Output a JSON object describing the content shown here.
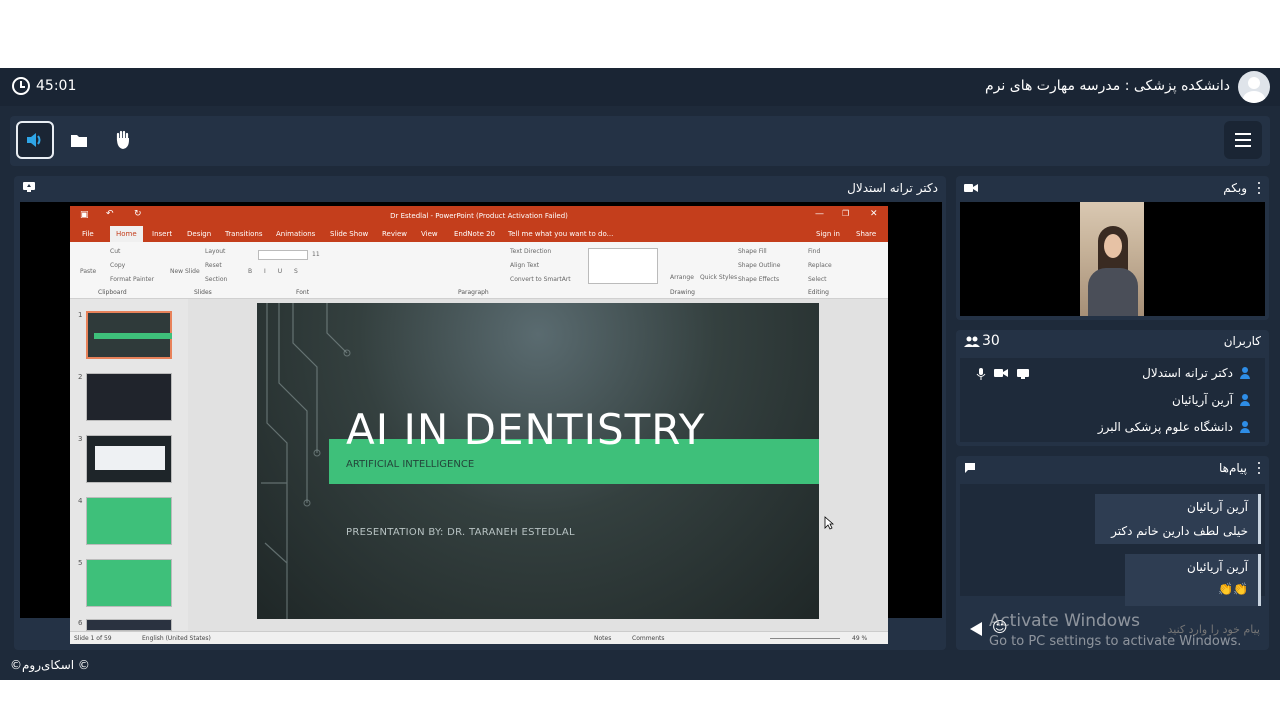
{
  "top_bar": {
    "timer": "45:01",
    "room_title": "دانشکده پزشکی : مدرسه مهارت های نرم"
  },
  "toolbar": {
    "buttons": [
      "speaker-icon",
      "folder-icon",
      "hand-icon"
    ],
    "menu": "menu-icon"
  },
  "presenter_panel": {
    "title": "دکتر ترانه استدلال"
  },
  "powerpoint": {
    "window_title": "Dr Estedlal - PowerPoint (Product Activation Failed)",
    "tell_me": "Tell me what you want to do...",
    "sign_in": "Sign in",
    "share": "Share",
    "tabs": [
      "File",
      "Home",
      "Insert",
      "Design",
      "Transitions",
      "Animations",
      "Slide Show",
      "Review",
      "View",
      "EndNote 20"
    ],
    "groups": [
      "Clipboard",
      "Slides",
      "Font",
      "Paragraph",
      "Drawing",
      "Editing"
    ],
    "clipboard_items": [
      "Paste",
      "Cut",
      "Copy",
      "Format Painter"
    ],
    "slides_items": [
      "New Slide",
      "Layout",
      "Reset",
      "Section"
    ],
    "paragraph_items": [
      "Text Direction",
      "Align Text",
      "Convert to SmartArt"
    ],
    "drawing_items": [
      "Arrange",
      "Quick Styles",
      "Shape Fill",
      "Shape Outline",
      "Shape Effects"
    ],
    "editing_items": [
      "Find",
      "Replace",
      "Select"
    ],
    "font_size": "11",
    "thumb_numbers": [
      "1",
      "2",
      "3",
      "4",
      "5",
      "6"
    ],
    "slide": {
      "title": "AI IN DENTISTRY",
      "subtitle": "ARTIFICIAL INTELLIGENCE",
      "presenter": "PRESENTATION BY: DR. TARANEH ESTEDLAL"
    },
    "status": {
      "slide_of": "Slide 1 of 59",
      "language": "English (United States)",
      "notes": "Notes",
      "comments": "Comments",
      "zoom": "49 %"
    }
  },
  "webcam_panel": {
    "title": "وبکم"
  },
  "users_panel": {
    "title": "کاربران",
    "count": "30",
    "users": [
      "دکتر ترانه استدلال",
      "آرین آریائیان",
      "دانشگاه علوم پزشکی البرز"
    ]
  },
  "messages_panel": {
    "title": "پیام‌ها",
    "messages": [
      {
        "author": "آرین آریائیان",
        "text": "خیلی لطف دارین خانم دکتر"
      },
      {
        "author": "آرین آریائیان",
        "text": "👏👏"
      }
    ],
    "input_placeholder": "پیام خود را وارد کنید"
  },
  "watermark": {
    "line1": "Activate Windows",
    "line2": "Go to PC settings to activate Windows."
  },
  "footer": {
    "brand": "©اسکای‌روم ©"
  }
}
